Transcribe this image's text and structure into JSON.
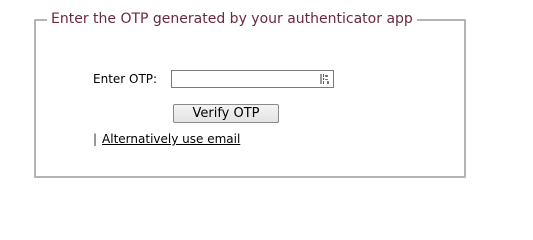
{
  "form": {
    "legend": "Enter the OTP generated by your authenticator app",
    "otp_label": "Enter OTP:",
    "otp_value": "",
    "otp_placeholder": "",
    "verify_label": "Verify OTP",
    "separator": "|",
    "alt_link_label": "Alternatively use email"
  },
  "colors": {
    "legend_text": "#6b2a3c",
    "border": "#b4b4b4"
  },
  "icons": {
    "input_icon": "password-manager-key-icon"
  }
}
